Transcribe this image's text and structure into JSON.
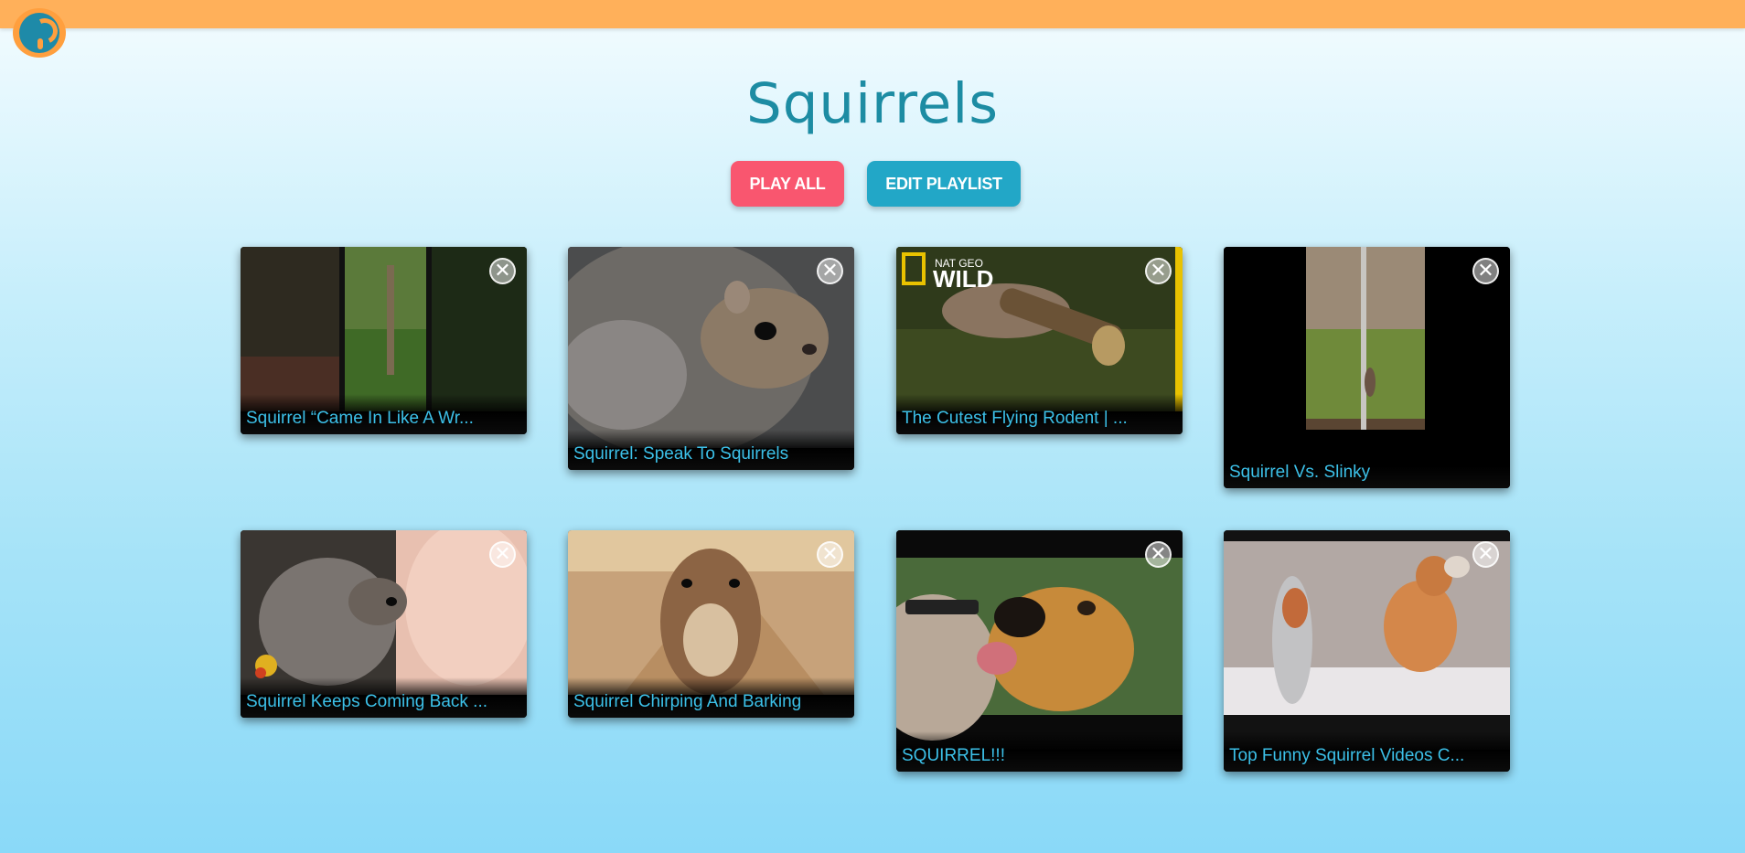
{
  "header": {
    "logo_icon": "question-logo-icon",
    "accent": "#ffb05a"
  },
  "playlist": {
    "title": "Squirrels",
    "play_all_label": "PLAY ALL",
    "edit_label": "EDIT PLAYLIST"
  },
  "videos": [
    {
      "title": "Squirrel “Came In Like A Wr..."
    },
    {
      "title": "Squirrel: Speak To Squirrels"
    },
    {
      "title": "The Cutest Flying Rodent | ...",
      "overlay_text": "NAT GEO\nWILD"
    },
    {
      "title": "Squirrel Vs. Slinky"
    },
    {
      "title": "Squirrel Keeps Coming Back ..."
    },
    {
      "title": "Squirrel Chirping And Barking"
    },
    {
      "title": "SQUIRREL!!!"
    },
    {
      "title": "Top Funny Squirrel Videos C..."
    }
  ],
  "close_glyph": "✕",
  "colors": {
    "play_button": "#f9566f",
    "edit_button": "#22a7c7",
    "title": "#1d8ca3",
    "caption": "#3cc0e8"
  }
}
